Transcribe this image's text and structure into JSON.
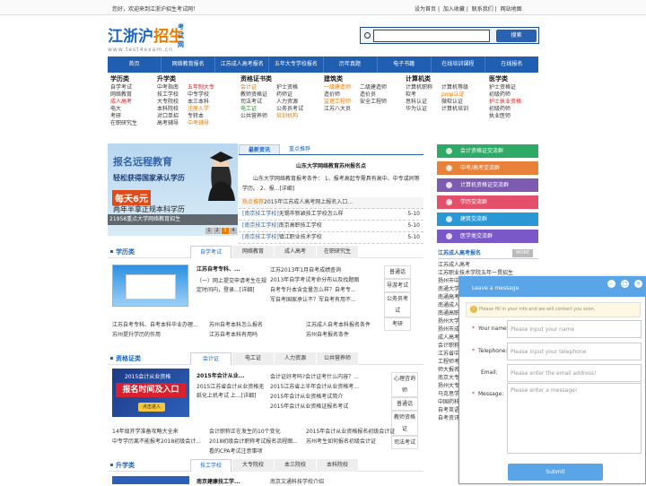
{
  "topbar": {
    "welcome": "您好，欢迎来到江浙沪招生考试网！",
    "links": [
      "设为首页",
      "加入收藏",
      "联系我们",
      "网站地图"
    ]
  },
  "logo": {
    "main1": "江浙沪",
    "main2": "招生",
    "sup": "考试网",
    "url": "www.test4exam.cn"
  },
  "search": {
    "button": "搜索",
    "placeholder": ""
  },
  "nav": [
    "首页",
    "网络教育报名",
    "江苏成人高考报名",
    "五年大专学校报名",
    "历年真题",
    "电子书籍",
    "在线培训课程",
    "在线报名"
  ],
  "categories": [
    {
      "title": "学历类",
      "cols": [
        [
          "自学考试",
          "网络教育",
          "成人高考",
          "电大",
          "考研",
          "在职研究生"
        ]
      ],
      "styles": [
        [
          "",
          "",
          "red",
          "",
          "",
          ""
        ]
      ]
    },
    {
      "title": "升学类",
      "cols": [
        [
          "中考指南",
          "技工学校",
          "大专院校",
          "本科院校",
          "对口单招",
          "高考辅导"
        ],
        [
          "五年制大专",
          "中专学校",
          "本三本科",
          "注册入学",
          "专转本",
          "中考辅导"
        ]
      ],
      "styles": [
        [
          "",
          "",
          "",
          "",
          "",
          ""
        ],
        [
          "red",
          "",
          "",
          "org",
          "",
          "org"
        ]
      ]
    },
    {
      "title": "资格证书类",
      "cols": [
        [
          "会计证",
          "教师资格证",
          "司法考试",
          "电工证",
          "公共营养师"
        ],
        [
          "护士资格",
          "药师证",
          "人力资源",
          "公务员考试",
          "培训机构"
        ]
      ],
      "styles": [
        [
          "org",
          "",
          "",
          "grn",
          ""
        ],
        [
          "",
          "",
          "",
          "",
          "org"
        ]
      ]
    },
    {
      "title": "建筑类",
      "cols": [
        [
          "一级建造师",
          "造价师",
          "监理工程师",
          "江苏八大员"
        ],
        [
          "二级建造师",
          "造价员",
          "安全工程师"
        ]
      ],
      "styles": [
        [
          "org",
          "",
          "org",
          ""
        ],
        [
          "",
          "",
          ""
        ]
      ]
    },
    {
      "title": "计算机类",
      "cols": [
        [
          "计算机职称",
          "软考",
          "思科认证",
          "华为认证"
        ],
        [
          "计算机等级",
          "pmp认证",
          "微软认证",
          "计算机培训"
        ]
      ],
      "styles": [
        [
          "",
          "",
          "",
          ""
        ],
        [
          "",
          "org",
          "",
          ""
        ]
      ]
    },
    {
      "title": "医学类",
      "cols": [
        [
          "护士资格证",
          "初级药师",
          "护士执业资格",
          "初级药师",
          "执业医师"
        ]
      ],
      "styles": [
        [
          "",
          "",
          "red",
          "",
          ""
        ]
      ]
    }
  ],
  "banner": {
    "t1": "报名远程教育",
    "t2": "轻松获得国家承认学历",
    "t3": "每天6元",
    "t4": "两年半拿正规本科学历",
    "caption": "21958重点大学网络教育招生",
    "pages": [
      "1",
      "2",
      "3",
      "4"
    ]
  },
  "news": {
    "tabs": [
      "最新资讯",
      "重点推荐"
    ],
    "headline": "山东大学网络教育苏州报名点",
    "summary": "山东大学网络教育报考条件： 1、报考高起专需具有高中、中专或同等学历。 2、报...[详细]",
    "items": [
      {
        "tag": "热点推荐",
        "text": "2015年江苏成人高考网上报名入口...",
        "date": ""
      },
      {
        "tag": "[南京技工学校]",
        "text": "无锡市新颖技工学校怎么样",
        "date": "5-10"
      },
      {
        "tag": "[南京技工学校]",
        "text": "南京高职技工学校",
        "date": "5-10"
      },
      {
        "tag": "[南京技工学校]",
        "text": "镇江职业技术学校",
        "date": "5-10"
      }
    ]
  },
  "right_buttons": [
    {
      "label": "会计资格证交流群",
      "color": "#2ea966"
    },
    {
      "label": "中考/高考交流群",
      "color": "#e8823a"
    },
    {
      "label": "计算机资格证交流群",
      "color": "#7c5bb0"
    },
    {
      "label": "学历交流群",
      "color": "#e4506b"
    },
    {
      "label": "建筑交流群",
      "color": "#2b98d6"
    },
    {
      "label": "医学类交流群",
      "color": "#7a58c7"
    }
  ],
  "sec1": {
    "title": "学历类",
    "tabs": [
      "自学考试",
      "网络教育",
      "成人高考",
      "在职研究生"
    ],
    "headline": "江苏自考专科、...",
    "summary": "（一）网上提交申请考生在规定时间内，登录...[详细]",
    "list": [
      "江苏2013年1月自考成绩查询",
      "2013年自学考试考命分布以及找题图",
      "自考专升本含金量怎么样？自考专...",
      "军自考国家承认不？军自考有用不..."
    ],
    "tags": [
      "普通话",
      "导游考试",
      "公务员考试",
      "考研"
    ],
    "bottom": [
      "江苏自考专科、自考本科毕业办理...",
      "苏州自考本科怎么报名",
      "江苏成人自考本科报名条件",
      "苏州提升学历的作用",
      "江苏自考本科有用吗",
      "苏州自考报名条件"
    ]
  },
  "sec2": {
    "title": "资格证类",
    "tabs": [
      "会计证",
      "电工证",
      "人力资源",
      "公共营养师"
    ],
    "img_a": "2015会计从业资格",
    "img_b": "报名时间及入口",
    "img_c": "点击进入",
    "headline": "2015年会计从业...",
    "summary": "2015江苏省会计从业资格无纸化上机考试 上...[详细]",
    "list": [
      "会计证好考吗?会计证考什么内容？...",
      "2015江苏省上半年会计从业资格考...",
      "2015年会计从业资格考试简介",
      "2015年会计从业资格证报名考试"
    ],
    "tags": [
      "心理咨询师",
      "普通话",
      "教师资格证",
      "司法考试"
    ],
    "bottom": [
      "14年级开学准备攻略大全来",
      "会计职称正在发生的10个变化",
      "2015年会计从业资格报名初级会计证",
      "中专学历离不能报考2018初级会计...",
      "2018初级会计职称考试报名流程图...",
      "苏州考生如何报名初级会计证",
      "",
      "看的CPA考试注意事项"
    ]
  },
  "sec3": {
    "title": "升学类",
    "tabs": [
      "技工学校",
      "大专院校",
      "本三院校",
      "本科院校"
    ],
    "headline": "南京建康技工学...",
    "summary": "南京文通科技学校介绍"
  },
  "right_list": {
    "title": "江苏成人高考报名",
    "more": "MORE",
    "items": [
      "江苏成人高考",
      "江苏职业技术学院五年一贯招生",
      "扬州市中专学历报名学校",
      "南通大学网络教育报名",
      "南通高考报名条件",
      "南通成人高考报名",
      "南通高职注册入学",
      "扬州大学成人高考",
      "扬州市成人高考报名",
      "成人高考",
      "会计职称",
      "江苏省中专",
      "工程师考试",
      "师大报名",
      "南京大专",
      "扬州大专",
      "马克思学",
      "中国药科大学",
      "自考英语",
      "自考资讯"
    ]
  },
  "chat": {
    "title": "Leave a message",
    "notice": "Please fill in your info and we will contact you soon.",
    "name_label": "Your name:",
    "name_ph": "Please input your name",
    "phone_label": "Telephone:",
    "phone_ph": "Please input your telephone",
    "email_label": "Email:",
    "email_ph": "Please enter the email address!",
    "msg_label": "Message:",
    "msg_ph": "Please enter a message!",
    "submit": "Submit"
  }
}
